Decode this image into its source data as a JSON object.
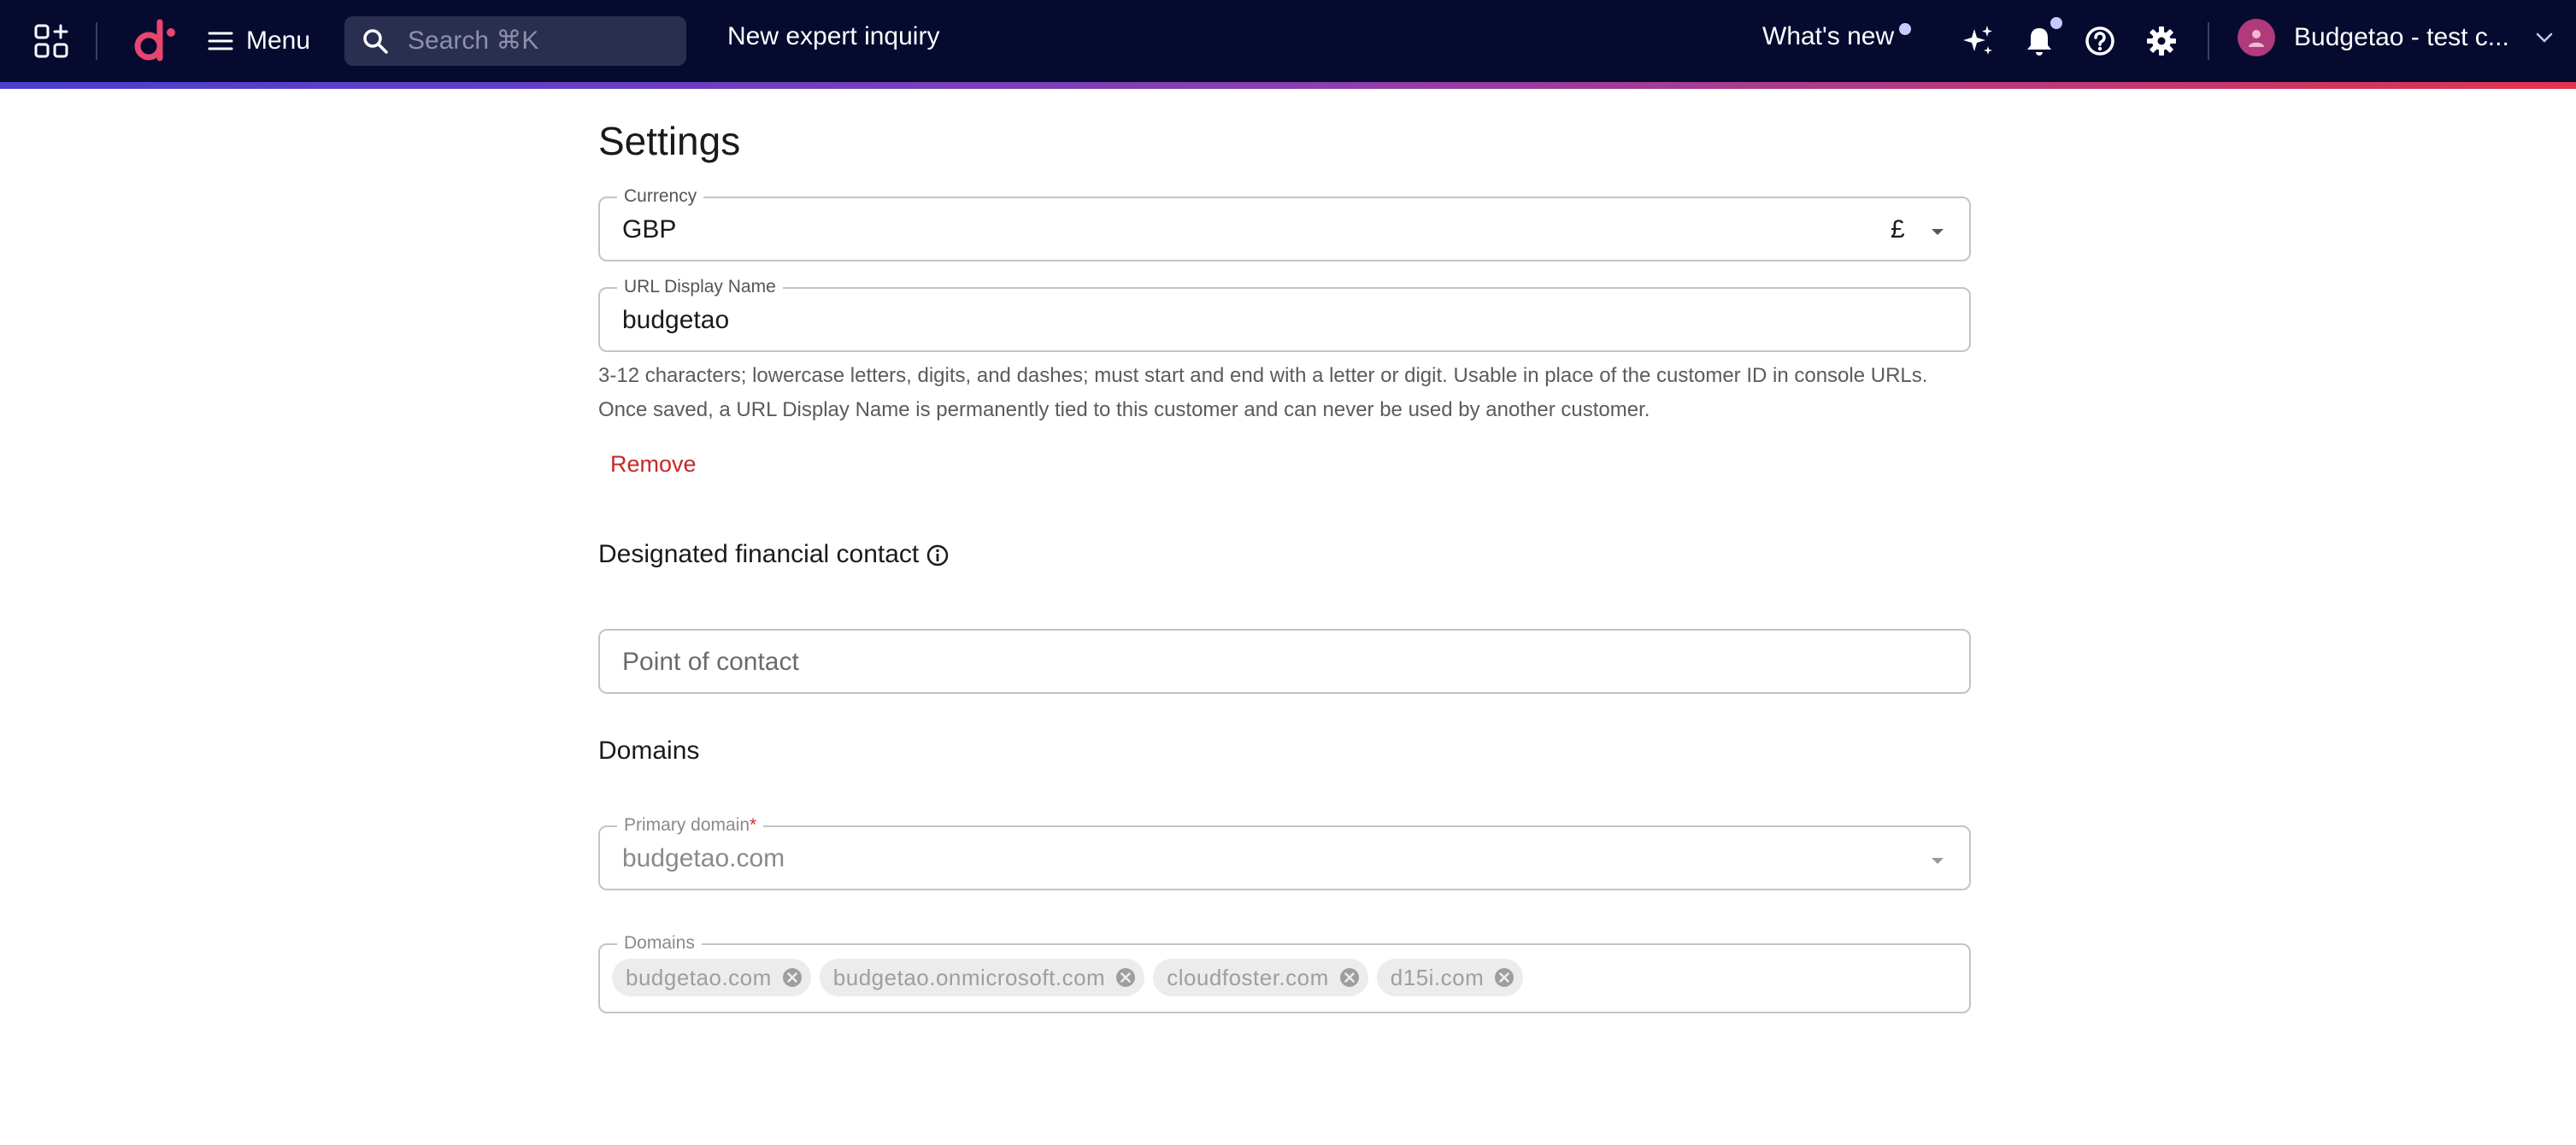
{
  "topbar": {
    "menu_label": "Menu",
    "search_placeholder": "Search ⌘K",
    "inquiry_label": "New expert inquiry",
    "whats_new_label": "What's new",
    "account_label": "Budgetao - test c...",
    "icons": [
      "apps-icon",
      "logo",
      "hamburger-icon",
      "search-icon",
      "sparkle-icon",
      "bell-icon",
      "help-icon",
      "gear-icon",
      "avatar-icon",
      "chevron-down-icon"
    ]
  },
  "page": {
    "title": "Settings",
    "currency": {
      "label": "Currency",
      "value": "GBP",
      "symbol": "£"
    },
    "url_display_name": {
      "label": "URL Display Name",
      "value": "budgetao",
      "helper": "3-12 characters; lowercase letters, digits, and dashes; must start and end with a letter or digit. Usable in place of the customer ID in console URLs. Once saved, a URL Display Name is permanently tied to this customer and can never be used by another customer.",
      "remove_label": "Remove"
    },
    "financial_contact": {
      "title": "Designated financial contact",
      "placeholder": "Point of contact"
    },
    "domains": {
      "title": "Domains",
      "primary_label": "Primary domain",
      "required_mark": "*",
      "primary_value": "budgetao.com",
      "domains_label": "Domains",
      "chips": [
        "budgetao.com",
        "budgetao.onmicrosoft.com",
        "cloudfoster.com",
        "d15i.com"
      ]
    }
  },
  "colors": {
    "topbar_bg": "#060a2f",
    "accent_red": "#c62828",
    "gradient": [
      "#4a3fd0",
      "#e2334f"
    ]
  }
}
